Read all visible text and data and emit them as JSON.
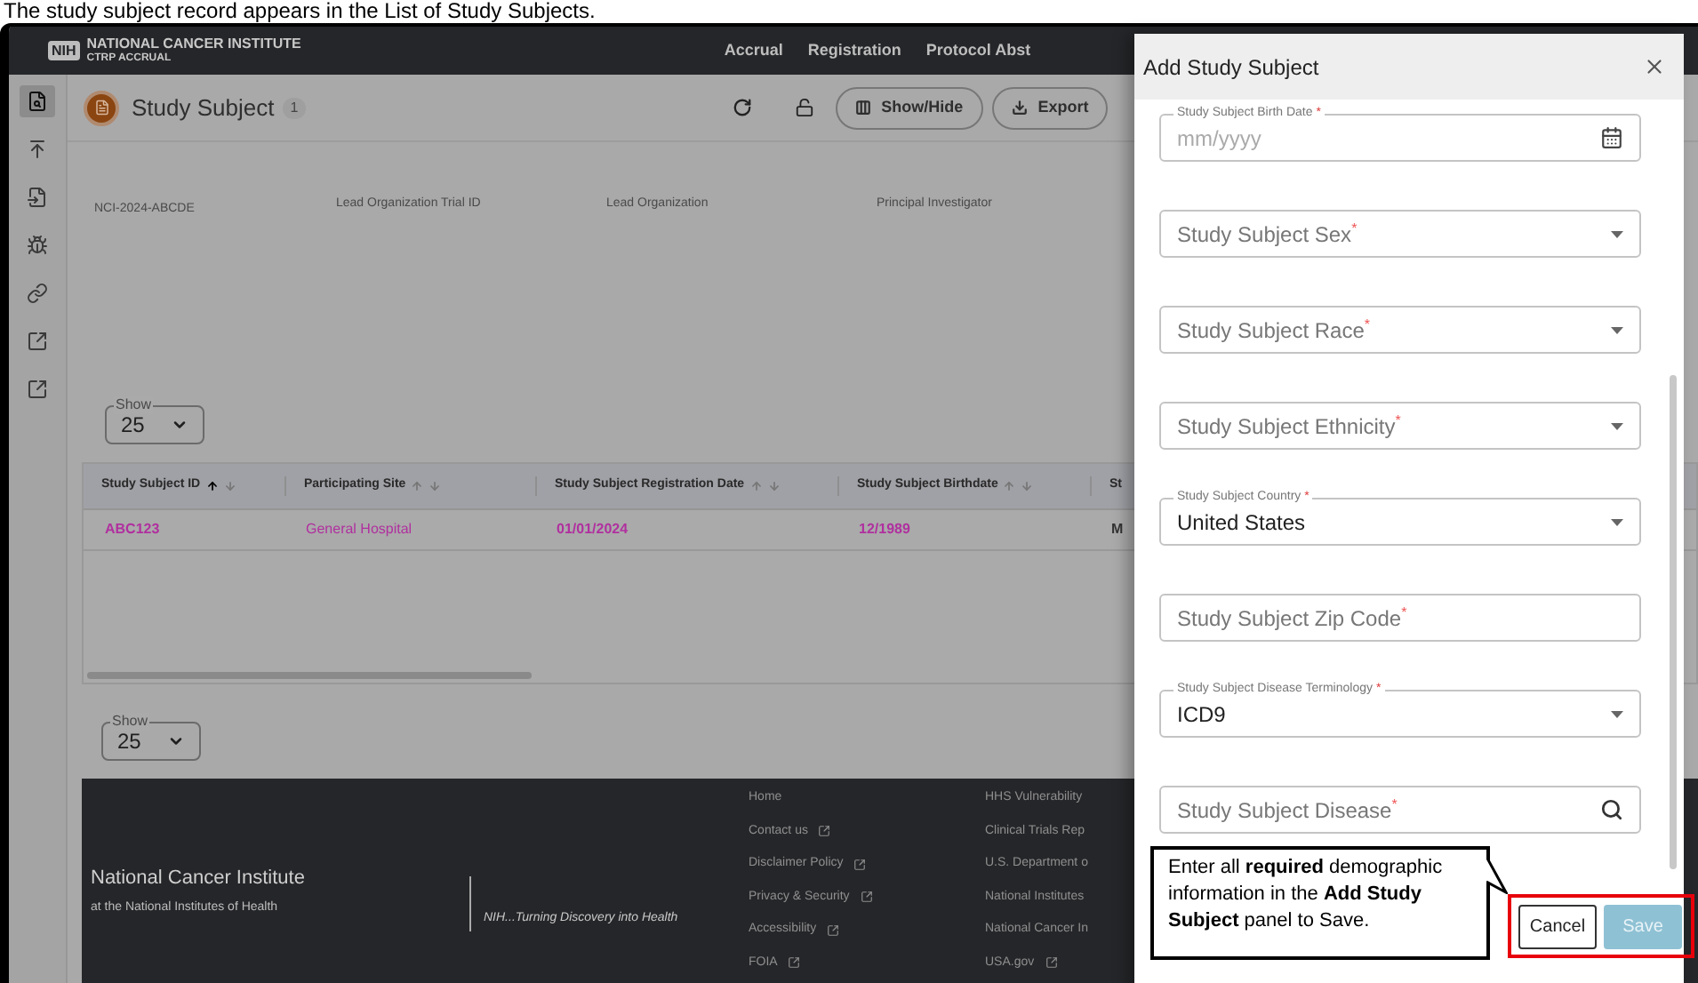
{
  "caption": "The study subject record appears in the List of Study Subjects.",
  "header": {
    "logo_badge": "NIH",
    "logo_title": "NATIONAL CANCER INSTITUTE",
    "logo_subtitle": "CTRP ACCRUAL",
    "nav": [
      "Accrual",
      "Registration",
      "Protocol Abst"
    ]
  },
  "sidebar": {
    "items": [
      {
        "selected": true
      },
      {
        "selected": false
      },
      {
        "selected": false
      },
      {
        "selected": false
      },
      {
        "selected": false
      },
      {
        "selected": false
      },
      {
        "selected": false
      }
    ]
  },
  "page": {
    "title": "Study Subject",
    "count": "1",
    "buttons": [
      "Show/Hide",
      "Export"
    ]
  },
  "trial": [
    "NCI-2024-ABCDE",
    "Lead Organization Trial ID",
    "Lead Organization",
    "Principal Investigator"
  ],
  "show_top": {
    "label": "Show",
    "value": "25"
  },
  "table": {
    "columns": [
      {
        "label": "Study Subject ID",
        "sorted_ascending": true
      },
      {
        "label": "Participating Site",
        "sorted_ascending": false
      },
      {
        "label": "Study Subject Registration Date",
        "sorted_ascending": false
      },
      {
        "label": "Study Subject Birthdate",
        "sorted_ascending": false
      },
      {
        "label": "St"
      }
    ],
    "rows": [
      [
        "ABC123",
        "General Hospital",
        "01/01/2024",
        "12/1989",
        "M"
      ]
    ]
  },
  "show_bottom": {
    "label": "Show",
    "value": "25"
  },
  "footer": {
    "org": "National Cancer Institute",
    "org_sub": "at the National Institutes of Health",
    "tagline": "NIH...Turning Discovery into Health",
    "links_1": [
      {
        "label": "Home",
        "external": false
      },
      {
        "label": "Contact us",
        "external": true
      },
      {
        "label": "Disclaimer Policy",
        "external": true
      },
      {
        "label": "Privacy & Security",
        "external": true
      },
      {
        "label": "Accessibility",
        "external": true
      },
      {
        "label": "FOIA",
        "external": true
      }
    ],
    "links_2": [
      {
        "label": "HHS Vulnerability",
        "external": false
      },
      {
        "label": "Clinical Trials Rep",
        "external": false
      },
      {
        "label": "U.S. Department o",
        "external": false
      },
      {
        "label": "National Institutes",
        "external": false
      },
      {
        "label": "National Cancer In",
        "external": false
      },
      {
        "label": "USA.gov",
        "external": true
      }
    ]
  },
  "modal": {
    "title": "Add Study Subject",
    "fields": [
      {
        "kind": "date",
        "label": "Study Subject Birth Date",
        "required_mark": "*",
        "placeholder": "mm/yyyy"
      },
      {
        "kind": "select",
        "label": "Study Subject Sex",
        "required_mark": "*"
      },
      {
        "kind": "select",
        "label": "Study Subject Race",
        "required_mark": "*"
      },
      {
        "kind": "select",
        "label": "Study Subject Ethnicity",
        "required_mark": "*"
      },
      {
        "kind": "select",
        "label": "Study Subject Country",
        "required_mark": "*",
        "value": "United States"
      },
      {
        "kind": "text",
        "label": "Study Subject Zip Code",
        "required_mark": "*"
      },
      {
        "kind": "select",
        "label": "Study Subject Disease Terminology",
        "required_mark": "*",
        "value": "ICD9"
      },
      {
        "kind": "search",
        "label": "Study Subject Disease",
        "required_mark": "*"
      }
    ],
    "callout": "Enter all **required** demographic information in the **Add Study Subject** panel to Save.",
    "buttons": [
      {
        "label": "Cancel",
        "disabled": false
      },
      {
        "label": "Save",
        "disabled": true
      }
    ]
  }
}
